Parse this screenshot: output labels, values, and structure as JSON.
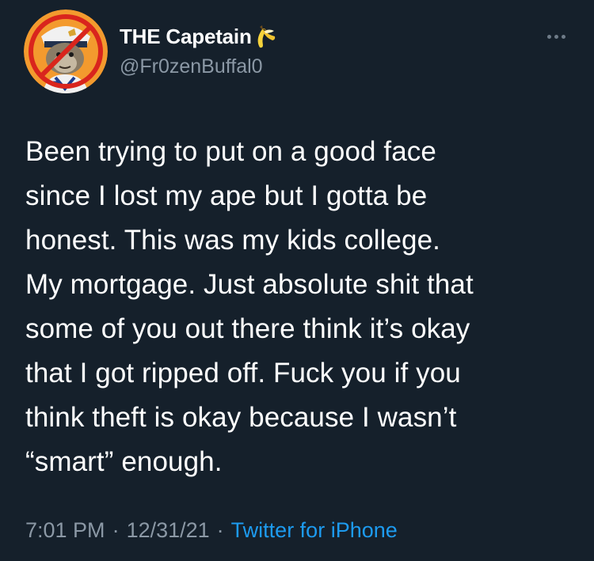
{
  "tweet": {
    "display_name": "THE Capetain",
    "handle": "@Fr0zenBuffal0",
    "text": "Been trying to put on a good face\nsince I lost my ape but I gotta be\nhonest. This was my kids college.\nMy mortgage. Just absolute shit that\nsome of you out there think it’s okay\nthat I got ripped off. Fuck you if you\nthink theft is okay because I wasn’t\n“smart” enough.",
    "time": "7:01 PM",
    "separator": "·",
    "date": "12/31/21",
    "source": "Twitter for iPhone"
  },
  "icons": {
    "avatar": "ape-avatar-with-prohibition-sign",
    "name_emoji": "banana-icon",
    "more": "more-options-icon"
  },
  "colors": {
    "background": "#15202b",
    "text": "#ffffff",
    "secondary_text": "#8b98a5",
    "link": "#1d9bf0",
    "avatar_background": "#f39a2e",
    "prohibition_red": "#d9251d"
  }
}
